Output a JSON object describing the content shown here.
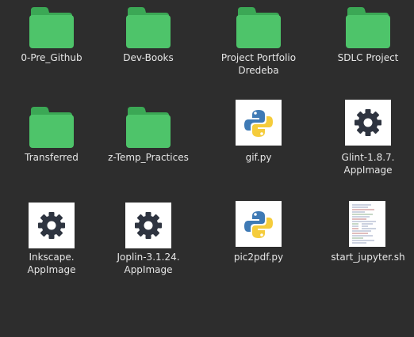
{
  "files": [
    {
      "name": "0-Pre_Github",
      "type": "folder"
    },
    {
      "name": "Dev-Books",
      "type": "folder"
    },
    {
      "name": "Project Portfolio\nDredeba",
      "type": "folder"
    },
    {
      "name": "SDLC Project",
      "type": "folder"
    },
    {
      "name": "Transferred",
      "type": "folder"
    },
    {
      "name": "z-Temp_Practices",
      "type": "folder"
    },
    {
      "name": "gif.py",
      "type": "python"
    },
    {
      "name": "Glint-1.8.7.\nAppImage",
      "type": "appimage"
    },
    {
      "name": "Inkscape.\nAppImage",
      "type": "appimage"
    },
    {
      "name": "Joplin-3.1.24.\nAppImage",
      "type": "appimage"
    },
    {
      "name": "pic2pdf.py",
      "type": "python"
    },
    {
      "name": "start_jupyter.sh",
      "type": "shell-script"
    }
  ],
  "colors": {
    "background": "#2d2d2d",
    "folder": "#4ec46a",
    "folder_tab": "#3ba855",
    "text": "#e6e6e6"
  }
}
